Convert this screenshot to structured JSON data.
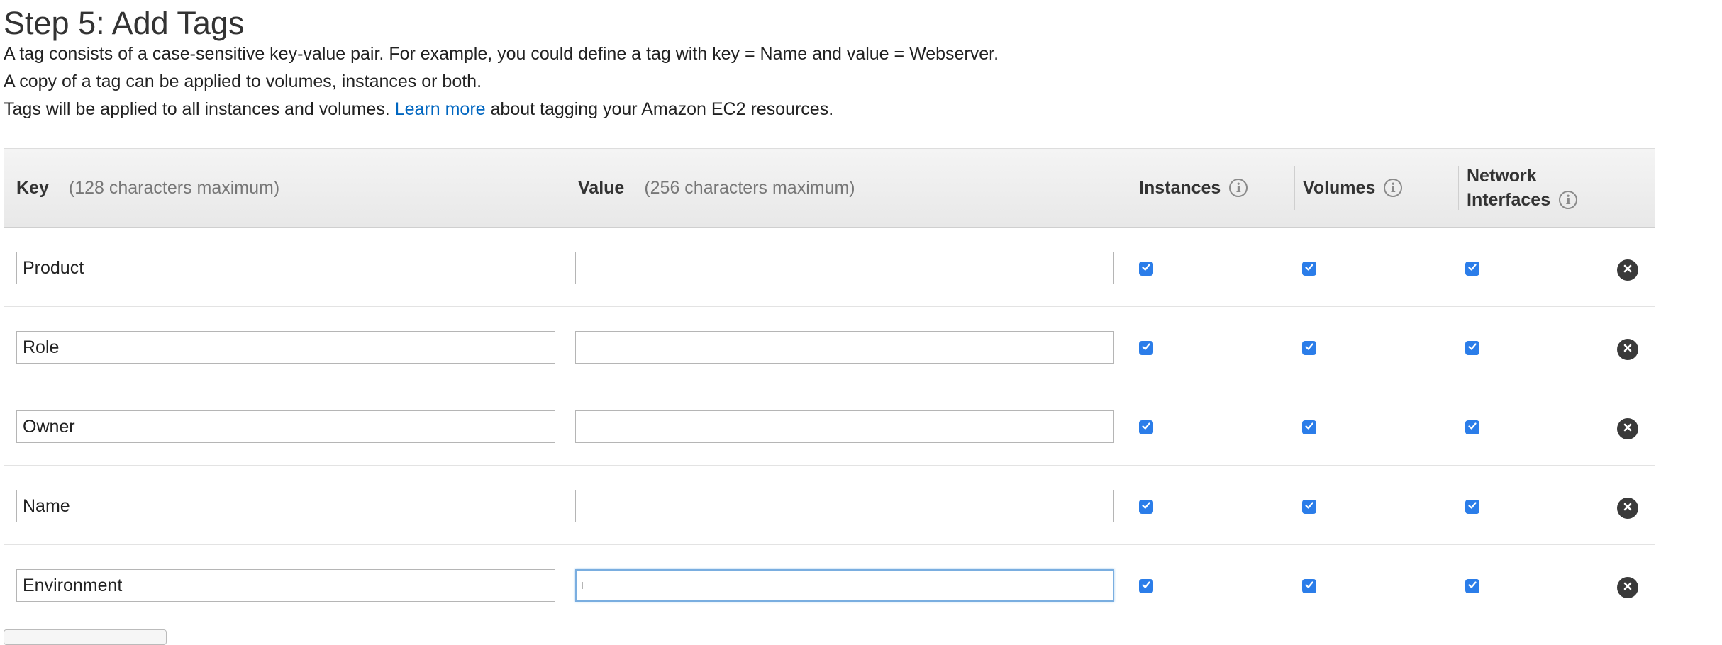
{
  "heading": {
    "title": "Step 5: Add Tags",
    "line1": "A tag consists of a case-sensitive key-value pair. For example, you could define a tag with key = Name and value = Webserver.",
    "line2": "A copy of a tag can be applied to volumes, instances or both.",
    "line3_prefix": "Tags will be applied to all instances and volumes.",
    "learn_more": "Learn more",
    "line3_suffix": "about tagging your Amazon EC2 resources."
  },
  "table": {
    "headers": {
      "key": "Key",
      "key_hint": "(128 characters maximum)",
      "value": "Value",
      "value_hint": "(256 characters maximum)",
      "instances": "Instances",
      "volumes": "Volumes",
      "network_line1": "Network",
      "network_line2": "Interfaces",
      "info_glyph": "i"
    },
    "rows": [
      {
        "key": "Product",
        "value": "",
        "instances": true,
        "volumes": true,
        "network_interfaces": true
      },
      {
        "key": "Role",
        "value": "",
        "instances": true,
        "volumes": true,
        "network_interfaces": true
      },
      {
        "key": "Owner",
        "value": "",
        "instances": true,
        "volumes": true,
        "network_interfaces": true
      },
      {
        "key": "Name",
        "value": "",
        "instances": true,
        "volumes": true,
        "network_interfaces": true
      },
      {
        "key": "Environment",
        "value": "",
        "instances": true,
        "volumes": true,
        "network_interfaces": true
      }
    ]
  },
  "colors": {
    "checkbox": "#2b7de9",
    "link": "#0066c0",
    "remove_icon": "#3a3a3a",
    "focus_border": "#7aaee0"
  },
  "icons": {
    "info": "info-circle-icon",
    "remove": "close-circle-icon",
    "check": "check-icon"
  }
}
